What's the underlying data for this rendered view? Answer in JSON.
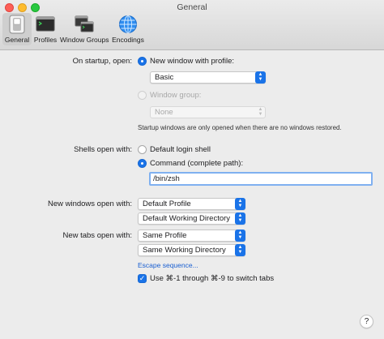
{
  "window": {
    "title": "General"
  },
  "toolbar": {
    "items": [
      {
        "label": "General",
        "icon": "switch-icon",
        "active": true
      },
      {
        "label": "Profiles",
        "icon": "terminal-icon",
        "active": false
      },
      {
        "label": "Window Groups",
        "icon": "window-groups-icon",
        "active": false
      },
      {
        "label": "Encodings",
        "icon": "globe-icon",
        "active": false
      }
    ]
  },
  "startup": {
    "label": "On startup, open:",
    "option_new_window": "New window with profile:",
    "profile_value": "Basic",
    "option_window_group": "Window group:",
    "group_value": "None",
    "note": "Startup windows are only opened when there are no windows restored."
  },
  "shells": {
    "label": "Shells open with:",
    "option_default": "Default login shell",
    "option_command": "Command (complete path):",
    "command_value": "/bin/zsh"
  },
  "new_windows": {
    "label": "New windows open with:",
    "profile_value": "Default Profile",
    "directory_value": "Default Working Directory"
  },
  "new_tabs": {
    "label": "New tabs open with:",
    "profile_value": "Same Profile",
    "directory_value": "Same Working Directory",
    "escape_link": "Escape sequence...",
    "switch_tabs_label": "Use ⌘-1 through ⌘-9 to switch tabs",
    "switch_tabs_checked": true
  },
  "help": {
    "label": "?"
  },
  "colors": {
    "accent": "#1a73e8",
    "link": "#1a5fd1"
  }
}
